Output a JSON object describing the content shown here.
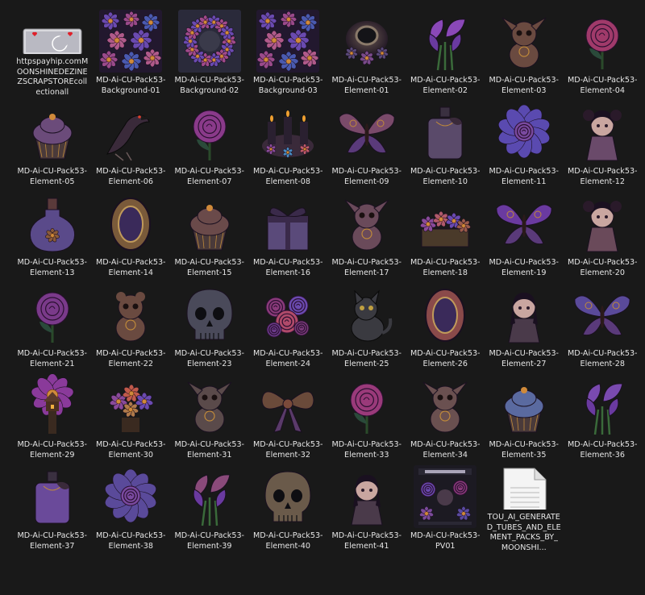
{
  "files": [
    {
      "name": "httpspayhip.comMOONSHINEDEZINEZSCRAPSTOREcollectionall",
      "icon": "web-shortcut-icon",
      "kind": "link"
    },
    {
      "name": "MD-Ai-CU-Pack53-Background-01",
      "icon": "flower-background-icon",
      "kind": "bg",
      "tint": "#5b3a8a"
    },
    {
      "name": "MD-Ai-CU-Pack53-Background-02",
      "icon": "wreath-background-icon",
      "kind": "wreath",
      "tint": "#6a3c93"
    },
    {
      "name": "MD-Ai-CU-Pack53-Background-03",
      "icon": "flower-background-icon",
      "kind": "bg",
      "tint": "#8a3f7c"
    },
    {
      "name": "MD-Ai-CU-Pack53-Element-01",
      "icon": "ornate-frame-icon",
      "kind": "frame",
      "tint": "#6b5a52"
    },
    {
      "name": "MD-Ai-CU-Pack53-Element-02",
      "icon": "calla-lily-icon",
      "kind": "lily",
      "tint": "#8a48b8"
    },
    {
      "name": "MD-Ai-CU-Pack53-Element-03",
      "icon": "creature-icon",
      "kind": "creature",
      "tint": "#6a4a40"
    },
    {
      "name": "MD-Ai-CU-Pack53-Element-04",
      "icon": "rose-icon",
      "kind": "rose",
      "tint": "#a03a6a"
    },
    {
      "name": "MD-Ai-CU-Pack53-Element-05",
      "icon": "cupcake-icon",
      "kind": "cupcake",
      "tint": "#6b4b7a"
    },
    {
      "name": "MD-Ai-CU-Pack53-Element-06",
      "icon": "raven-icon",
      "kind": "raven",
      "tint": "#3a2a3a"
    },
    {
      "name": "MD-Ai-CU-Pack53-Element-07",
      "icon": "rose-icon",
      "kind": "rose",
      "tint": "#8a3a8a"
    },
    {
      "name": "MD-Ai-CU-Pack53-Element-08",
      "icon": "candles-icon",
      "kind": "candles",
      "tint": "#7a4a6a"
    },
    {
      "name": "MD-Ai-CU-Pack53-Element-09",
      "icon": "butterfly-icon",
      "kind": "butterfly",
      "tint": "#7a4a6a"
    },
    {
      "name": "MD-Ai-CU-Pack53-Element-10",
      "icon": "perfume-bottle-icon",
      "kind": "bottle",
      "tint": "#5a4a6a"
    },
    {
      "name": "MD-Ai-CU-Pack53-Element-11",
      "icon": "rose-icon",
      "kind": "bigflower",
      "tint": "#5a4ab0"
    },
    {
      "name": "MD-Ai-CU-Pack53-Element-12",
      "icon": "doll-icon",
      "kind": "doll",
      "tint": "#6a4a6a"
    },
    {
      "name": "MD-Ai-CU-Pack53-Element-13",
      "icon": "potion-bottle-icon",
      "kind": "potion",
      "tint": "#5a4a8a"
    },
    {
      "name": "MD-Ai-CU-Pack53-Element-14",
      "icon": "oval-frame-icon",
      "kind": "oval",
      "tint": "#7a5a3a"
    },
    {
      "name": "MD-Ai-CU-Pack53-Element-15",
      "icon": "cupcake-icon",
      "kind": "cupcake",
      "tint": "#6a4a4a"
    },
    {
      "name": "MD-Ai-CU-Pack53-Element-16",
      "icon": "gift-box-icon",
      "kind": "gift",
      "tint": "#5a4a7a"
    },
    {
      "name": "MD-Ai-CU-Pack53-Element-17",
      "icon": "creature-icon",
      "kind": "creature",
      "tint": "#6a4a5a"
    },
    {
      "name": "MD-Ai-CU-Pack53-Element-18",
      "icon": "flower-box-icon",
      "kind": "flowerbox",
      "tint": "#8a4a9a"
    },
    {
      "name": "MD-Ai-CU-Pack53-Element-19",
      "icon": "butterfly-icon",
      "kind": "butterfly",
      "tint": "#6a3aa0"
    },
    {
      "name": "MD-Ai-CU-Pack53-Element-20",
      "icon": "doll-icon",
      "kind": "doll",
      "tint": "#6a4a5a"
    },
    {
      "name": "MD-Ai-CU-Pack53-Element-21",
      "icon": "rose-icon",
      "kind": "rose",
      "tint": "#7a3a8a"
    },
    {
      "name": "MD-Ai-CU-Pack53-Element-22",
      "icon": "bear-icon",
      "kind": "bear",
      "tint": "#6a4a40"
    },
    {
      "name": "MD-Ai-CU-Pack53-Element-23",
      "icon": "skull-icon",
      "kind": "skull",
      "tint": "#4a4a5a"
    },
    {
      "name": "MD-Ai-CU-Pack53-Element-24",
      "icon": "rose-bouquet-icon",
      "kind": "bouquet",
      "tint": "#8a3a7a"
    },
    {
      "name": "MD-Ai-CU-Pack53-Element-25",
      "icon": "cat-icon",
      "kind": "cat",
      "tint": "#3a3a40"
    },
    {
      "name": "MD-Ai-CU-Pack53-Element-26",
      "icon": "oval-frame-icon",
      "kind": "oval",
      "tint": "#8a4a4a"
    },
    {
      "name": "MD-Ai-CU-Pack53-Element-27",
      "icon": "girl-icon",
      "kind": "girl",
      "tint": "#4a3a4a"
    },
    {
      "name": "MD-Ai-CU-Pack53-Element-28",
      "icon": "butterfly-icon",
      "kind": "butterfly",
      "tint": "#5a4a9a"
    },
    {
      "name": "MD-Ai-CU-Pack53-Element-29",
      "icon": "treehouse-icon",
      "kind": "house",
      "tint": "#8a3a9a"
    },
    {
      "name": "MD-Ai-CU-Pack53-Element-30",
      "icon": "flower-tree-icon",
      "kind": "tree",
      "tint": "#8a5a6a"
    },
    {
      "name": "MD-Ai-CU-Pack53-Element-31",
      "icon": "creature-icon",
      "kind": "creature",
      "tint": "#5a4a4a"
    },
    {
      "name": "MD-Ai-CU-Pack53-Element-32",
      "icon": "bow-icon",
      "kind": "bow",
      "tint": "#6a4a3a"
    },
    {
      "name": "MD-Ai-CU-Pack53-Element-33",
      "icon": "rose-icon",
      "kind": "rose",
      "tint": "#9a3a7a"
    },
    {
      "name": "MD-Ai-CU-Pack53-Element-34",
      "icon": "creature-icon",
      "kind": "creature",
      "tint": "#6a5050"
    },
    {
      "name": "MD-Ai-CU-Pack53-Element-35",
      "icon": "cupcake-icon",
      "kind": "cupcake",
      "tint": "#5a6aa0"
    },
    {
      "name": "MD-Ai-CU-Pack53-Element-36",
      "icon": "calla-lily-icon",
      "kind": "lily",
      "tint": "#7a4ab0"
    },
    {
      "name": "MD-Ai-CU-Pack53-Element-37",
      "icon": "perfume-bottle-icon",
      "kind": "bottle",
      "tint": "#6a4a9a"
    },
    {
      "name": "MD-Ai-CU-Pack53-Element-38",
      "icon": "rose-icon",
      "kind": "bigflower",
      "tint": "#5a4a9a"
    },
    {
      "name": "MD-Ai-CU-Pack53-Element-39",
      "icon": "calla-lily-icon",
      "kind": "lily",
      "tint": "#8a4a7a"
    },
    {
      "name": "MD-Ai-CU-Pack53-Element-40",
      "icon": "skull-icon",
      "kind": "skull",
      "tint": "#6a5a4a"
    },
    {
      "name": "MD-Ai-CU-Pack53-Element-41",
      "icon": "girl-icon",
      "kind": "girl",
      "tint": "#4a3a4a"
    },
    {
      "name": "MD-Ai-CU-Pack53-PV01",
      "icon": "preview-image-icon",
      "kind": "preview",
      "tint": "#3a3a4a"
    },
    {
      "name": "TOU_AI_GENERATED_TUBES_AND_ELEMENT_PACKS_BY_MOONSHI...",
      "icon": "text-document-icon",
      "kind": "doc"
    }
  ]
}
